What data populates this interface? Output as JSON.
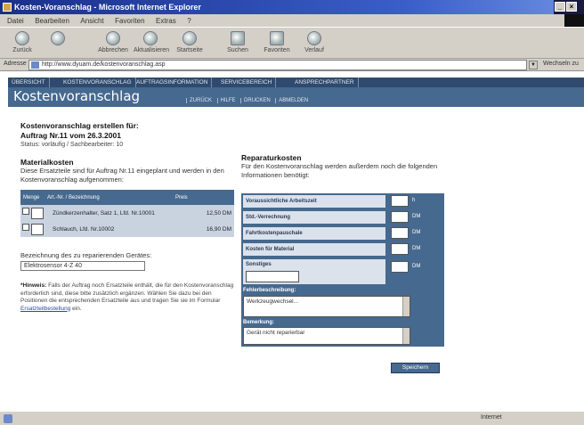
{
  "window": {
    "title": "Kosten-Voranschlag - Microsoft Internet Explorer",
    "menu": [
      "Datei",
      "Bearbeiten",
      "Ansicht",
      "Favoriten",
      "Extras",
      "?"
    ]
  },
  "toolbar": {
    "buttons": [
      {
        "label": "Zurück",
        "icon": "back-arrow-icon"
      },
      {
        "label": "",
        "icon": "forward-arrow-icon"
      },
      {
        "label": "Abbrechen",
        "icon": "stop-icon"
      },
      {
        "label": "Aktualisieren",
        "icon": "refresh-icon"
      },
      {
        "label": "Startseite",
        "icon": "home-icon"
      },
      {
        "label": "Suchen",
        "icon": "search-icon"
      },
      {
        "label": "Favoriten",
        "icon": "favorites-icon"
      },
      {
        "label": "Verlauf",
        "icon": "history-icon"
      }
    ]
  },
  "address": {
    "label": "Adresse",
    "url": "http://www.dyuam.de/kostenvoranschlag.asp",
    "go_label": "Wechseln zu"
  },
  "nav": {
    "tabs": [
      "ÜBERSICHT",
      "KOSTENVORANSCHLAG",
      "AUFTRAGSINFORMATION",
      "SERVICEBEREICH",
      "ANSPRECHPARTNER"
    ]
  },
  "header": {
    "title": "Kostenvoranschlag",
    "sublinks": [
      "ZURÜCK",
      "HILFE",
      "DRUCKEN",
      "ABMELDEN"
    ]
  },
  "intro": {
    "heading_line1": "Kostenvoranschlag erstellen für:",
    "heading_line2": "Auftrag Nr.11 vom 26.3.2001",
    "status_line": "Status: vorläufig / Sachbearbeiter: 10"
  },
  "materials": {
    "title": "Materialkosten",
    "description": "Diese Ersatzteile sind für Auftrag Nr.11 eingeplant und werden in den Kostenvoranschlag aufgenommen:",
    "columns": [
      "Menge",
      "Art.-Nr. / Bezeichnung",
      "Preis"
    ],
    "rows": [
      {
        "checked": false,
        "name": "Zündkerzenhalter, Satz 1, Lfd. Nr.10001",
        "price": "12,50 DM"
      },
      {
        "checked": false,
        "name": "Schlauch, Lfd. Nr.10002",
        "price": "16,90 DM"
      }
    ]
  },
  "device": {
    "label": "Bezeichnung des zu reparierenden Gerätes:",
    "value": "Elektrosensor 4-Z 40"
  },
  "footnote": {
    "bold_start": "*Hinweis:",
    "text": " Falls der Auftrag noch Ersatzteile enthält, die für den Kostenvoranschlag erforderlich sind, diese bitte zusätzlich ergänzen. Wählen Sie dazu bei den Positionen die entsprechenden Ersatzteile aus und tragen Sie sie im Formular",
    "link": "Ersatzteilbestellung",
    "end": " ein."
  },
  "repair": {
    "title": "Reparaturkosten",
    "description": "Für den Kostenvoranschlag werden außerdem noch die folgenden Informationen benötigt:",
    "rows": [
      {
        "label": "Voraussichtliche Arbeitszeit",
        "unit": "h"
      },
      {
        "label": "Std.-Verrechnung",
        "unit": "DM"
      },
      {
        "label": "Fahrtkostenpauschale",
        "unit": "DM"
      },
      {
        "label": "Kosten für Material",
        "unit": "DM"
      },
      {
        "label": "Sonstiges",
        "unit": "DM"
      }
    ],
    "fault_label": "Fehlerbeschreibung:",
    "fault_value": "Werkzeugwechsel...",
    "comment_label": "Bemerkung:",
    "comment_value": "Gerät nicht reparierbar"
  },
  "submit_label": "Speichern",
  "status": {
    "zone": "Internet"
  },
  "colors": {
    "header_blue": "#46698f",
    "nav_dark": "#2f4a6e",
    "table_row": "#c9d3e0"
  }
}
